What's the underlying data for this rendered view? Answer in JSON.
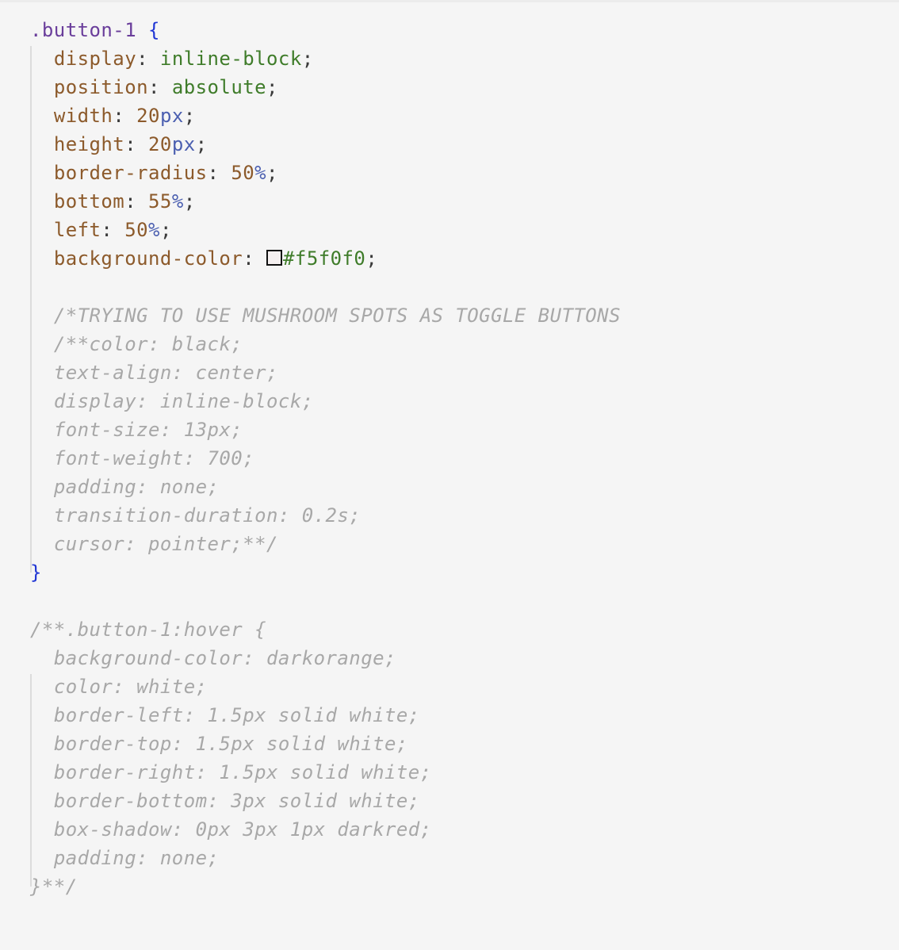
{
  "colors": {
    "background": "#f5f5f5",
    "selector": "#6a3e9b",
    "brace": "#1f35d4",
    "property": "#8c5a2b",
    "value": "#3f7c2a",
    "unit": "#4b5fb0",
    "comment": "#a8a8a8",
    "swatch": "#f5f0f0"
  },
  "rule": {
    "selector": ".button-1",
    "open_brace": "{",
    "close_brace": "}",
    "declarations": [
      {
        "prop": "display",
        "value": "inline-block"
      },
      {
        "prop": "position",
        "value": "absolute"
      },
      {
        "prop": "width",
        "num": "20",
        "unit": "px"
      },
      {
        "prop": "height",
        "num": "20",
        "unit": "px"
      },
      {
        "prop": "border-radius",
        "num": "50",
        "unit": "%"
      },
      {
        "prop": "bottom",
        "num": "55",
        "unit": "%"
      },
      {
        "prop": "left",
        "num": "50",
        "unit": "%"
      },
      {
        "prop": "background-color",
        "value": "#f5f0f0",
        "swatch": true
      }
    ],
    "comment_lines": [
      "/*TRYING TO USE MUSHROOM SPOTS AS TOGGLE BUTTONS",
      "/**color: black;",
      "text-align: center;",
      "display: inline-block;",
      "font-size: 13px;",
      "font-weight: 700;",
      "padding: none;",
      "transition-duration: 0.2s;",
      "cursor: pointer;**/"
    ]
  },
  "commented_rule": {
    "header": "/**.button-1:hover {",
    "lines": [
      "background-color: darkorange;",
      "color: white;",
      "border-left: 1.5px solid white;",
      "border-top: 1.5px solid white;",
      "border-right: 1.5px solid white;",
      "border-bottom: 3px solid white;",
      "box-shadow: 0px 3px 1px darkred;",
      "padding: none;"
    ],
    "footer": "}**/"
  }
}
